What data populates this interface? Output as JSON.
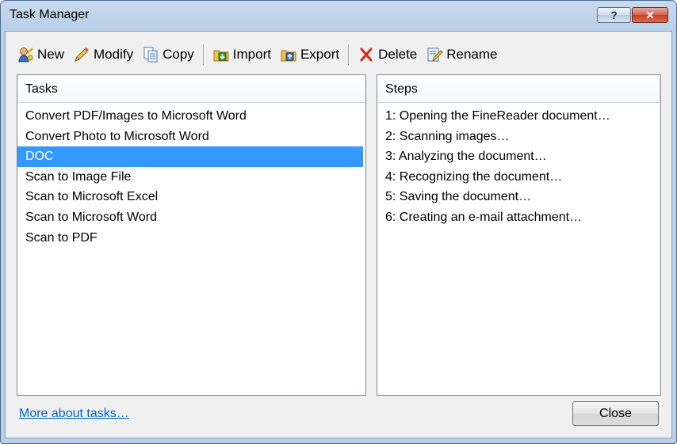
{
  "window": {
    "title": "Task Manager",
    "help_label": "?",
    "close_label": "✕"
  },
  "toolbar": {
    "new_label": "New",
    "modify_label": "Modify",
    "copy_label": "Copy",
    "import_label": "Import",
    "export_label": "Export",
    "delete_label": "Delete",
    "rename_label": "Rename"
  },
  "tasks": {
    "header": "Tasks",
    "items": [
      "Convert PDF/Images to Microsoft Word",
      "Convert Photo to Microsoft Word",
      "DOC",
      "Scan to Image File",
      "Scan to Microsoft Excel",
      "Scan to Microsoft Word",
      "Scan to PDF"
    ],
    "selected": "DOC"
  },
  "steps": {
    "header": "Steps",
    "items": [
      "1: Opening the FineReader document…",
      "2: Scanning images…",
      "3: Analyzing the document…",
      "4: Recognizing the document…",
      "5: Saving the document…",
      "6: Creating an e-mail attachment…"
    ]
  },
  "footer": {
    "link_label": "More about tasks…",
    "close_button": "Close"
  },
  "colors": {
    "selection": "#3399ff",
    "link": "#0066cc",
    "title_close": "#c4412a"
  },
  "icons": [
    "new-task-icon",
    "modify-pencil-icon",
    "copy-icon",
    "import-icon",
    "export-icon",
    "delete-x-icon",
    "rename-icon"
  ]
}
